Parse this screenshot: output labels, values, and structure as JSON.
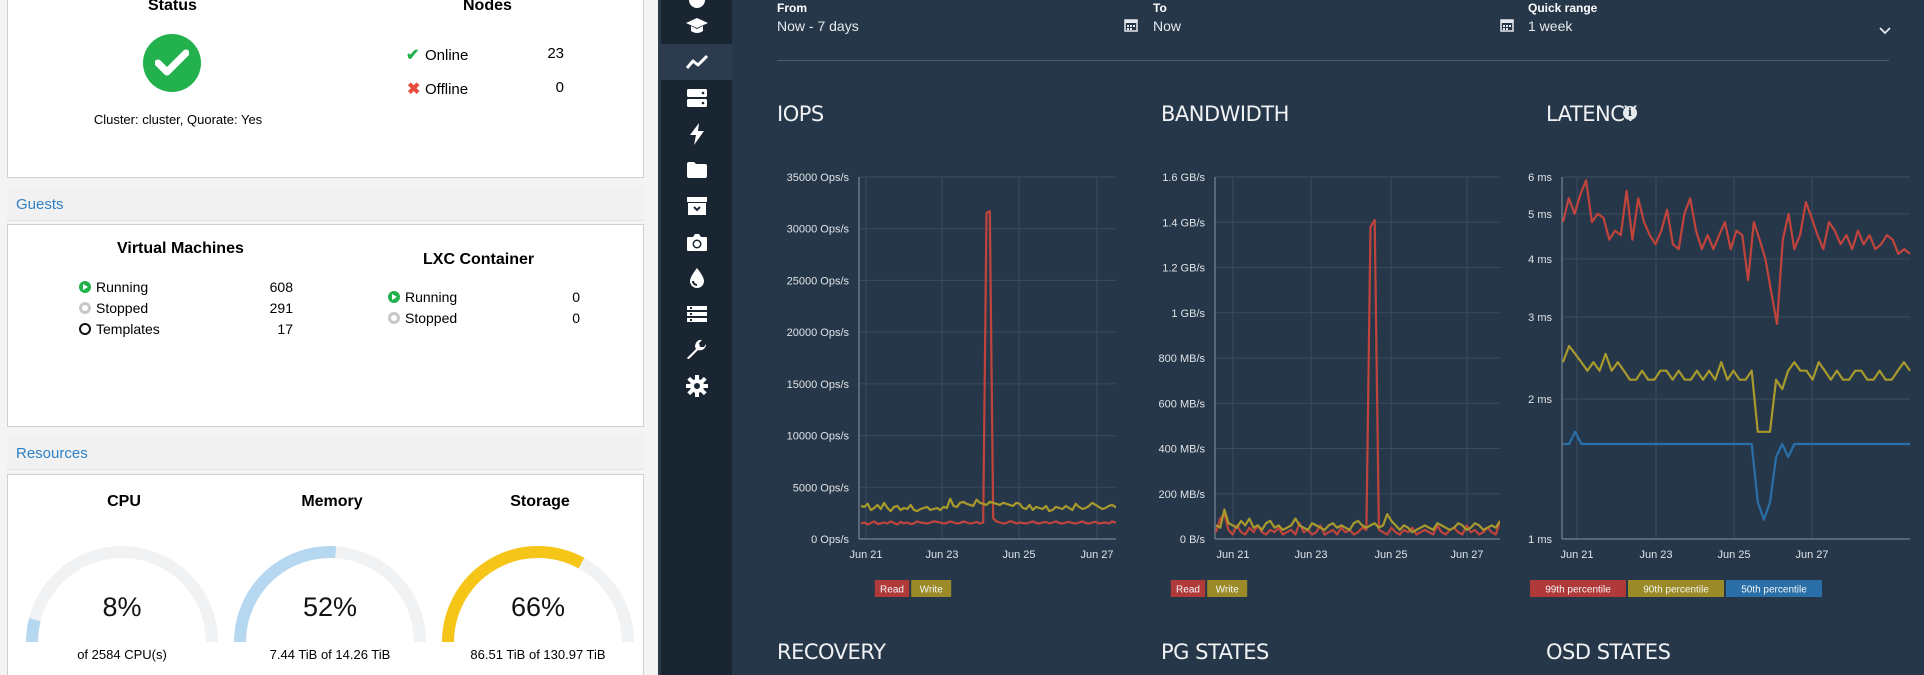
{
  "status": {
    "title": "Status",
    "cluster_text": "Cluster: cluster, Quorate: Yes",
    "ok_color": "#22b14c"
  },
  "nodes": {
    "title": "Nodes",
    "online_label": "Online",
    "online_count": "23",
    "offline_label": "Offline",
    "offline_count": "0"
  },
  "guests": {
    "header": "Guests",
    "vm": {
      "title": "Virtual Machines",
      "running_label": "Running",
      "running_count": "608",
      "stopped_label": "Stopped",
      "stopped_count": "291",
      "templates_label": "Templates",
      "templates_count": "17"
    },
    "lxc": {
      "title": "LXC Container",
      "running_label": "Running",
      "running_count": "0",
      "stopped_label": "Stopped",
      "stopped_count": "0"
    }
  },
  "resources": {
    "header": "Resources",
    "cpu": {
      "label": "CPU",
      "value": "8%",
      "fraction": 0.08,
      "detail": "of 2584 CPU(s)",
      "color": "#b6d7f0"
    },
    "memory": {
      "label": "Memory",
      "value": "52%",
      "fraction": 0.52,
      "detail": "7.44 TiB of 14.26 TiB",
      "color": "#b6d7f0"
    },
    "storage": {
      "label": "Storage",
      "value": "66%",
      "fraction": 0.66,
      "detail": "86.51 TiB of 130.97 TiB",
      "color": "#f5c518"
    }
  },
  "sidebar": {
    "icons": [
      "dashboard-icon",
      "graduation-cap-icon",
      "chart-line-icon",
      "server-icon",
      "bolt-icon",
      "folder-icon",
      "archive-icon",
      "camera-icon",
      "tint-icon",
      "list-icon",
      "wrench-icon",
      "gear-icon"
    ]
  },
  "timerange": {
    "from_label": "From",
    "from_value": "Now - 7 days",
    "to_label": "To",
    "to_value": "Now",
    "quick_label": "Quick range",
    "quick_value": "1 week"
  },
  "sections": {
    "recovery": "RECOVERY",
    "pg_states": "PG STATES",
    "osd_states": "OSD STATES"
  },
  "chart_data": [
    {
      "type": "line",
      "title": "IOPS",
      "x_ticks": [
        "Jun 21",
        "Jun 23",
        "Jun 25",
        "Jun 27"
      ],
      "y_ticks": [
        "0 Ops/s",
        "5000 Ops/s",
        "10000 Ops/s",
        "15000 Ops/s",
        "20000 Ops/s",
        "25000 Ops/s",
        "30000 Ops/s",
        "35000 Ops/s"
      ],
      "ylim": [
        0,
        35000
      ],
      "legend": [
        {
          "name": "Read",
          "color": "#b03a3a"
        },
        {
          "name": "Write",
          "color": "#9a8a28"
        }
      ],
      "series": [
        {
          "name": "Read",
          "color": "#c0443c",
          "values": [
            1500,
            1600,
            1400,
            1550,
            1700,
            1450,
            1500,
            1600,
            1500,
            1700,
            1550,
            1400,
            1650,
            1500,
            1600,
            1450,
            1500,
            1700,
            1600,
            1550,
            1500,
            1600,
            1700,
            1650,
            1600,
            1500,
            1550,
            1700,
            1600,
            1500,
            1550,
            1700,
            1600,
            1500,
            1550,
            1650,
            1500,
            1600,
            31500,
            31700,
            2000,
            1700,
            1600,
            1500,
            1550,
            1700,
            1650,
            1500,
            1600,
            1550,
            1500,
            1600,
            1700,
            1550,
            1500,
            1600,
            1650,
            1500,
            1600,
            1700,
            1550,
            1500,
            1600,
            1650,
            1550,
            1500,
            1600,
            1700,
            1550,
            1500,
            1600,
            1650,
            1500,
            1550,
            1600,
            1500,
            1700,
            1600,
            1500,
            1550
          ]
        },
        {
          "name": "Write",
          "color": "#a89a2c",
          "values": [
            3200,
            3100,
            3400,
            2800,
            3000,
            3300,
            2900,
            3500,
            3000,
            2700,
            3100,
            3200,
            2800,
            3000,
            2900,
            3300,
            2800,
            2700,
            2900,
            3000,
            3100,
            2800,
            2900,
            3000,
            2800,
            3100,
            3000,
            3900,
            3200,
            3100,
            3500,
            3600,
            3400,
            3300,
            3200,
            3800,
            3500,
            3400,
            3300,
            3600,
            3500,
            3400,
            3300,
            3500,
            3400,
            3300,
            3200,
            3500,
            3400,
            3000,
            2900,
            3300,
            2800,
            3100,
            3000,
            2900,
            3200,
            2700,
            2800,
            3100,
            3000,
            2900,
            3200,
            3000,
            2800,
            3400,
            3100,
            2900,
            3000,
            3200,
            3500,
            3300,
            3100,
            2900,
            3000,
            3200,
            3300,
            3100,
            2900,
            2800
          ]
        }
      ]
    },
    {
      "type": "line",
      "title": "BANDWIDTH",
      "x_ticks": [
        "Jun 21",
        "Jun 23",
        "Jun 25",
        "Jun 27"
      ],
      "y_ticks": [
        "0 B/s",
        "200 MB/s",
        "400 MB/s",
        "600 MB/s",
        "800 MB/s",
        "1 GB/s",
        "1.2 GB/s",
        "1.4 GB/s",
        "1.6 GB/s"
      ],
      "ylim": [
        0,
        1600
      ],
      "y_unit": "MB/s",
      "legend": [
        {
          "name": "Read",
          "color": "#b03a3a"
        },
        {
          "name": "Write",
          "color": "#9a8a28"
        }
      ],
      "series": [
        {
          "name": "Read",
          "color": "#c0443c",
          "values": [
            30,
            90,
            110,
            40,
            20,
            60,
            30,
            20,
            50,
            30,
            60,
            30,
            20,
            40,
            30,
            50,
            20,
            30,
            40,
            20,
            70,
            30,
            40,
            20,
            30,
            60,
            20,
            30,
            40,
            20,
            50,
            30,
            40,
            20,
            30,
            50,
            40,
            1380,
            1410,
            40,
            30,
            20,
            50,
            30,
            20,
            40,
            30,
            50,
            20,
            30,
            40,
            30,
            20,
            60,
            30,
            20,
            40,
            50,
            30,
            20,
            60,
            30,
            40,
            20,
            30,
            50,
            30,
            20,
            80
          ]
        },
        {
          "name": "Write",
          "color": "#a89a2c",
          "values": [
            60,
            50,
            130,
            70,
            60,
            50,
            80,
            60,
            90,
            50,
            60,
            40,
            70,
            80,
            50,
            60,
            40,
            50,
            60,
            90,
            60,
            50,
            40,
            70,
            60,
            50,
            40,
            60,
            70,
            50,
            60,
            50,
            40,
            70,
            80,
            60,
            50,
            60,
            70,
            50,
            60,
            110,
            80,
            60,
            40,
            60,
            50,
            30,
            40,
            50,
            60,
            50,
            40,
            70,
            60,
            50,
            40,
            50,
            70,
            60,
            40,
            50,
            70,
            60,
            40,
            50,
            60,
            50,
            80
          ]
        }
      ]
    },
    {
      "type": "line",
      "title": "LATENCY",
      "x_ticks": [
        "Jun 21",
        "Jun 23",
        "Jun 25",
        "Jun 27"
      ],
      "y_ticks": [
        "1 ms",
        "2 ms",
        "3 ms",
        "4 ms",
        "5 ms",
        "6 ms"
      ],
      "ylim": [
        1,
        6
      ],
      "y_scale": "log",
      "legend": [
        {
          "name": "99th percentile",
          "color": "#b03a3a"
        },
        {
          "name": "90th percentile",
          "color": "#9a8a28"
        },
        {
          "name": "50th percentile",
          "color": "#2a6fa8"
        }
      ],
      "series": [
        {
          "name": "99th percentile",
          "color": "#c0443c",
          "values": [
            4.8,
            5.4,
            5.0,
            5.5,
            5.9,
            4.8,
            5.0,
            4.9,
            4.4,
            4.6,
            4.5,
            5.6,
            4.4,
            5.4,
            4.8,
            4.5,
            4.3,
            4.6,
            5.1,
            4.3,
            4.2,
            5.0,
            5.4,
            4.6,
            4.2,
            4.5,
            4.2,
            4.5,
            4.8,
            4.2,
            4.6,
            4.5,
            3.6,
            4.8,
            4.4,
            4.0,
            3.4,
            2.9,
            4.4,
            5.0,
            4.2,
            4.5,
            5.3,
            4.9,
            4.5,
            4.2,
            4.8,
            4.6,
            4.3,
            4.5,
            4.2,
            4.6,
            4.3,
            4.5,
            4.2,
            4.3,
            4.5,
            4.4,
            4.1,
            4.2,
            4.1
          ]
        },
        {
          "name": "90th percentile",
          "color": "#a89a2c",
          "values": [
            2.4,
            2.6,
            2.5,
            2.4,
            2.3,
            2.4,
            2.3,
            2.5,
            2.3,
            2.4,
            2.3,
            2.2,
            2.2,
            2.3,
            2.2,
            2.2,
            2.3,
            2.3,
            2.2,
            2.3,
            2.2,
            2.2,
            2.3,
            2.2,
            2.3,
            2.2,
            2.4,
            2.2,
            2.3,
            2.2,
            2.2,
            2.3,
            1.7,
            1.7,
            1.7,
            2.2,
            2.1,
            2.3,
            2.4,
            2.3,
            2.3,
            2.2,
            2.4,
            2.3,
            2.2,
            2.3,
            2.2,
            2.2,
            2.3,
            2.3,
            2.2,
            2.2,
            2.3,
            2.2,
            2.2,
            2.3,
            2.4,
            2.3
          ]
        },
        {
          "name": "50th percentile",
          "color": "#2a6fa8",
          "values": [
            1.6,
            1.6,
            1.7,
            1.6,
            1.6,
            1.6,
            1.6,
            1.6,
            1.6,
            1.6,
            1.6,
            1.6,
            1.6,
            1.6,
            1.6,
            1.6,
            1.6,
            1.6,
            1.6,
            1.6,
            1.6,
            1.6,
            1.6,
            1.6,
            1.6,
            1.6,
            1.6,
            1.6,
            1.6,
            1.6,
            1.6,
            1.6,
            1.2,
            1.1,
            1.2,
            1.5,
            1.6,
            1.5,
            1.6,
            1.6,
            1.6,
            1.6,
            1.6,
            1.6,
            1.6,
            1.6,
            1.6,
            1.6,
            1.6,
            1.6,
            1.6,
            1.6,
            1.6,
            1.6,
            1.6,
            1.6,
            1.6,
            1.6
          ]
        }
      ]
    }
  ]
}
